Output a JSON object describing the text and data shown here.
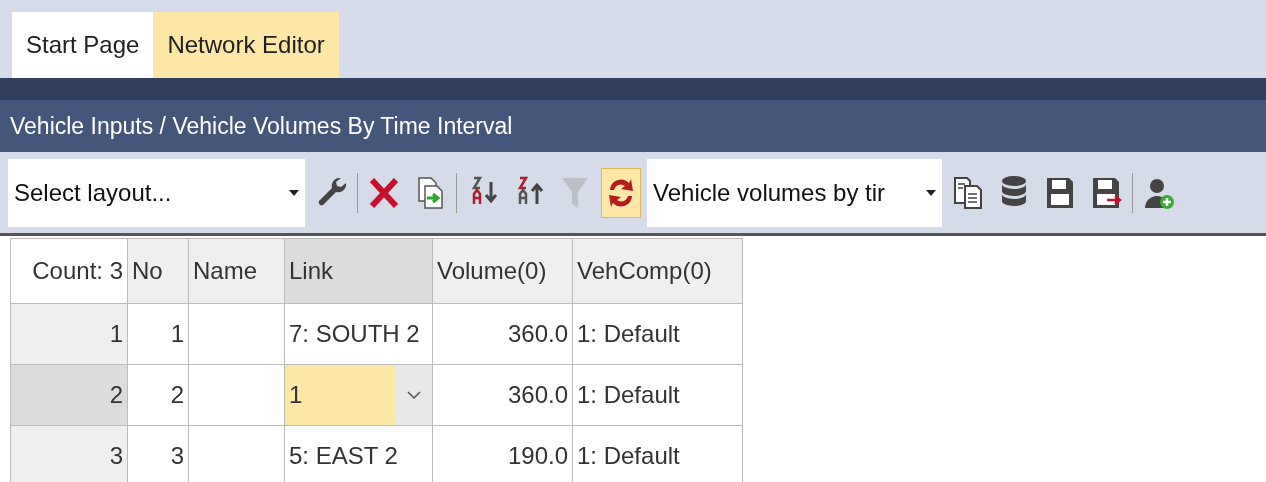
{
  "tabs": [
    {
      "label": "Start Page",
      "selected": false
    },
    {
      "label": "Network Editor",
      "selected": true
    }
  ],
  "panel_title": "Vehicle Inputs / Vehicle Volumes By Time Interval",
  "toolbar": {
    "layout_select": {
      "value": "Select layout..."
    },
    "buttons": [
      {
        "kind": "wrench",
        "active": false,
        "disabled": false
      },
      {
        "kind": "delete",
        "active": false,
        "disabled": false
      },
      {
        "kind": "duplicate",
        "active": false,
        "disabled": false
      },
      {
        "kind": "sort_asc",
        "active": false,
        "disabled": false
      },
      {
        "kind": "sort_desc",
        "active": false,
        "disabled": false
      },
      {
        "kind": "filter",
        "active": false,
        "disabled": true
      },
      {
        "kind": "sync",
        "active": true,
        "disabled": false
      }
    ],
    "list_select": {
      "value": "Vehicle volumes by tir"
    },
    "buttons_right": [
      {
        "kind": "copy",
        "active": false,
        "disabled": false
      },
      {
        "kind": "database",
        "active": false,
        "disabled": false
      },
      {
        "kind": "save",
        "active": false,
        "disabled": false
      },
      {
        "kind": "save_as",
        "active": false,
        "disabled": false
      },
      {
        "kind": "user_add",
        "active": false,
        "disabled": false
      }
    ]
  },
  "table": {
    "columns": [
      {
        "label": "Count: 3",
        "selected": false
      },
      {
        "label": "No",
        "selected": false
      },
      {
        "label": "Name",
        "selected": false
      },
      {
        "label": "Link",
        "selected": true
      },
      {
        "label": "Volume(0)",
        "selected": false
      },
      {
        "label": "VehComp(0)",
        "selected": false
      }
    ],
    "rows": [
      {
        "row_header": "1",
        "no": "1",
        "link": "7: SOUTH 2",
        "link_editing": false,
        "volume": "360.0",
        "veh_comp": "1: Default",
        "selected": false
      },
      {
        "row_header": "2",
        "no": "2",
        "link": "1",
        "link_editing": true,
        "volume": "360.0",
        "veh_comp": "1: Default",
        "selected": true
      },
      {
        "row_header": "3",
        "no": "3",
        "link": "5: EAST 2",
        "link_editing": false,
        "volume": "190.0",
        "veh_comp": "1: Default",
        "selected": false
      }
    ]
  }
}
